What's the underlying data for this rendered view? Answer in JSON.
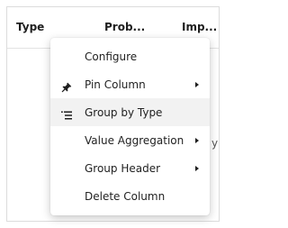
{
  "grid": {
    "columns": [
      {
        "label": "Type"
      },
      {
        "label": "Prob..."
      },
      {
        "label": "Imp..."
      }
    ],
    "partial_cell_glyph": "y"
  },
  "column_menu": {
    "items": [
      {
        "label": "Configure",
        "icon": null,
        "has_submenu": false,
        "active": false
      },
      {
        "label": "Pin Column",
        "icon": "pin-icon",
        "has_submenu": true,
        "active": false
      },
      {
        "label": "Group by Type",
        "icon": "group-list-icon",
        "has_submenu": false,
        "active": true
      },
      {
        "label": "Value Aggregation",
        "icon": null,
        "has_submenu": true,
        "active": false
      },
      {
        "label": "Group Header",
        "icon": null,
        "has_submenu": true,
        "active": false
      },
      {
        "label": "Delete Column",
        "icon": null,
        "has_submenu": false,
        "active": false
      }
    ]
  },
  "colors": {
    "hover_background": "#f2f2f2",
    "text": "#222222",
    "border": "#dcdcdc"
  }
}
